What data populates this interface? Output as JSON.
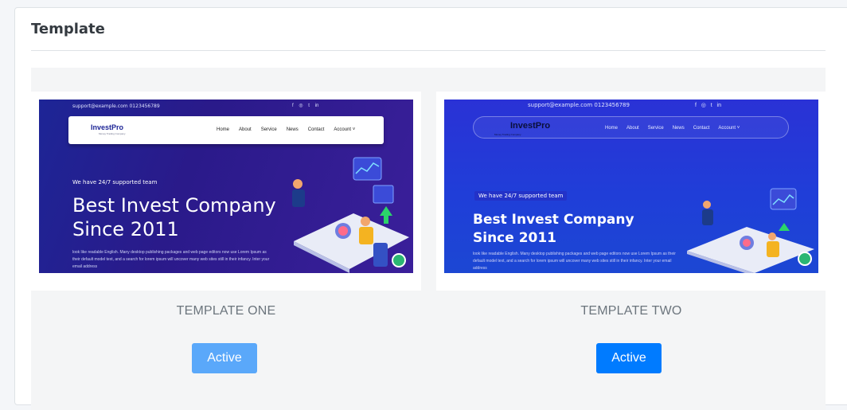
{
  "card": {
    "title": "Template"
  },
  "templates": [
    {
      "name": "TEMPLATE ONE",
      "button_label": "Active",
      "preview": {
        "contact": "support@example.com   0123456789",
        "logo": {
          "main": "InvestPro",
          "sub": "Money Trading Company"
        },
        "menu": [
          "Home",
          "About",
          "Service",
          "News",
          "Contact",
          "Account ˅"
        ],
        "tagline": "We have 24/7 supported team",
        "headline": "Best Invest Company Since 2011",
        "paragraph": "look like readable English. Many desktop publishing packages and web page editors now use Lorem Ipsum as their default model text, and a search for lorem ipsum will uncover many web sites still in their infancy. Inter your email address"
      }
    },
    {
      "name": "TEMPLATE TWO",
      "button_label": "Active",
      "preview": {
        "contact": "support@example.com   0123456789",
        "logo": {
          "main": "InvestPro",
          "sub": "Money Trading Company"
        },
        "menu": [
          "Home",
          "About",
          "Service",
          "News",
          "Contact",
          "Account ˅"
        ],
        "tagline": "We have 24/7 supported team",
        "headline": "Best Invest Company Since 2011",
        "paragraph": "look like readable English. Many desktop publishing packages and web page editors now use Lorem Ipsum as their default model text, and a search for lorem ipsum will uncover many web sites still in their infancy. Inter your email address"
      }
    }
  ],
  "colors": {
    "active_disabled": "#5aa8fa",
    "active_primary": "#007bff",
    "preview_one_bg": "#1d2596",
    "preview_two_bg": "#2a32d6",
    "chat_green": "#2bb673"
  },
  "icons": [
    "facebook-icon",
    "twitter-icon",
    "linkedin-icon",
    "instagram-icon",
    "envelope-icon",
    "phone-icon",
    "chat-icon"
  ]
}
